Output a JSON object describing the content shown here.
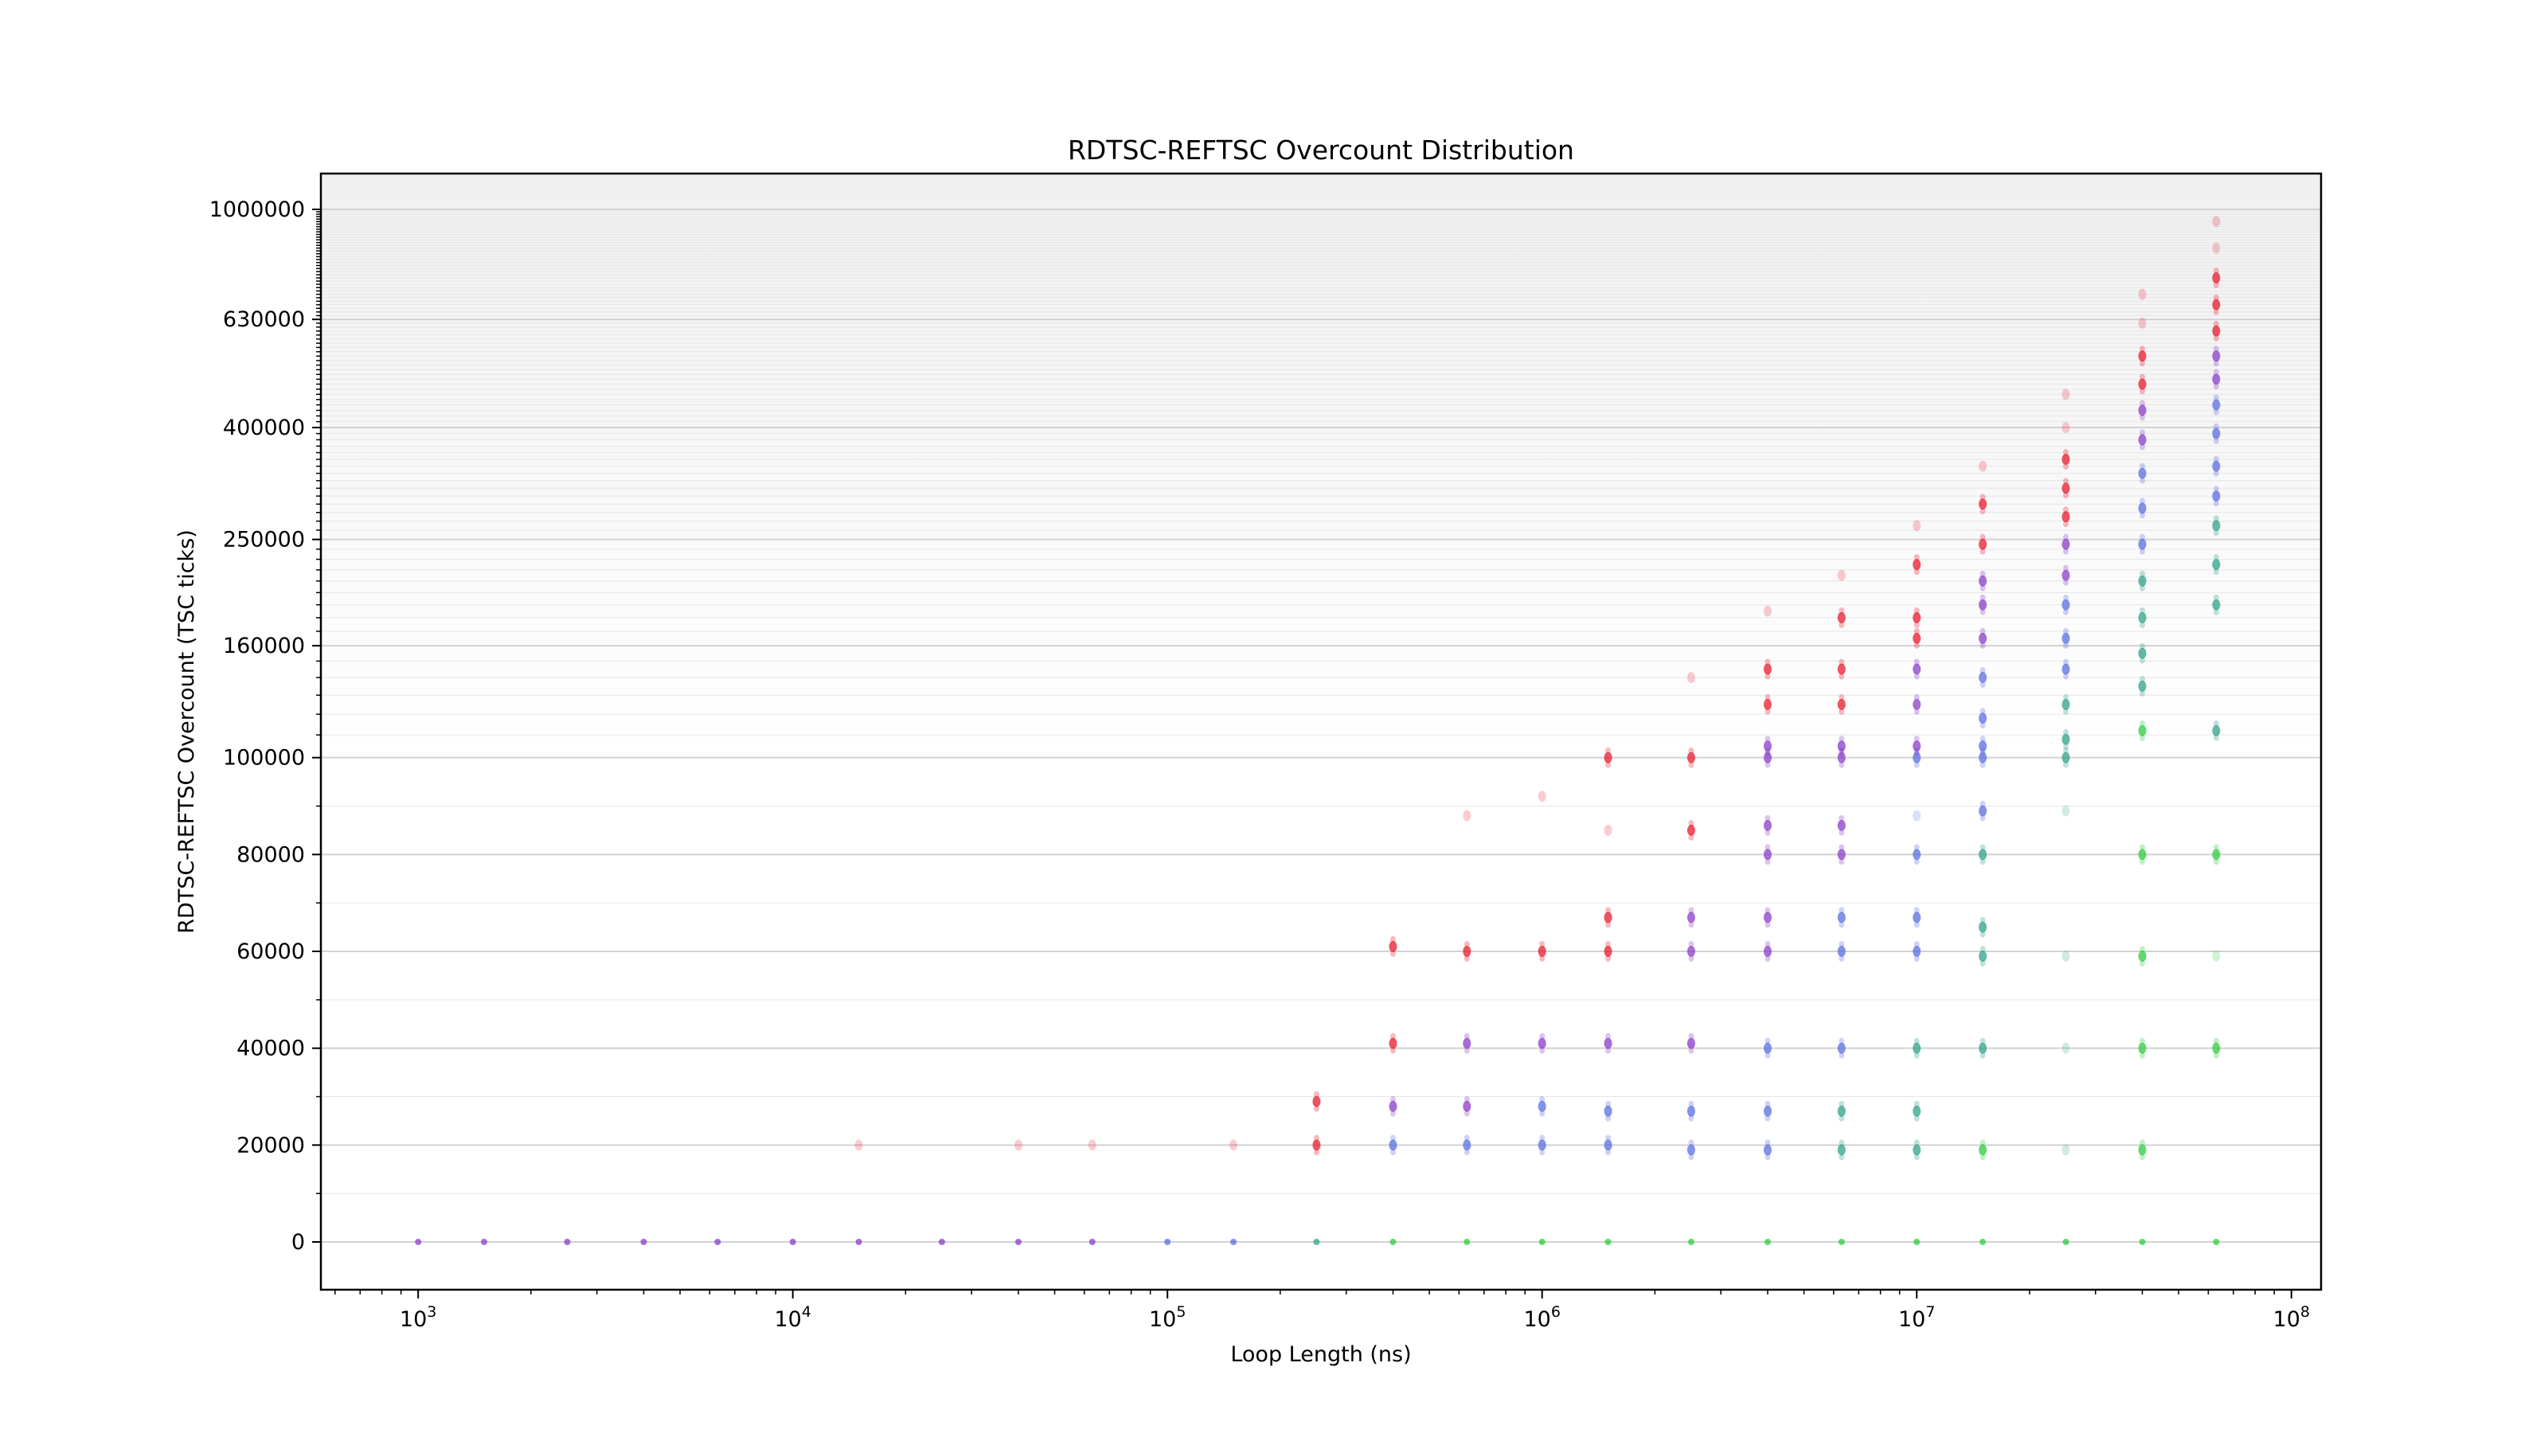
{
  "chart_data": {
    "type": "scatter",
    "title": "RDTSC-REFTSC Overcount Distribution",
    "xlabel": "Loop Length (ns)",
    "ylabel": "RDTSC-REFTSC Overcount (TSC ticks)",
    "x_scale": "log",
    "y_scale": "symlog",
    "xlim": [
      550,
      120000000
    ],
    "ylim": [
      -10000,
      1100000
    ],
    "x_ticks": [
      {
        "value": 1000,
        "base": "10",
        "exp": "3"
      },
      {
        "value": 10000,
        "base": "10",
        "exp": "4"
      },
      {
        "value": 100000,
        "base": "10",
        "exp": "5"
      },
      {
        "value": 1000000,
        "base": "10",
        "exp": "6"
      },
      {
        "value": 10000000,
        "base": "10",
        "exp": "7"
      },
      {
        "value": 100000000,
        "base": "10",
        "exp": "8"
      }
    ],
    "y_ticks": [
      {
        "value": 0,
        "label": "0"
      },
      {
        "value": 20000,
        "label": "20000"
      },
      {
        "value": 40000,
        "label": "40000"
      },
      {
        "value": 60000,
        "label": "60000"
      },
      {
        "value": 80000,
        "label": "80000"
      },
      {
        "value": 100000,
        "label": "100000"
      },
      {
        "value": 160000,
        "label": "160000"
      },
      {
        "value": 250000,
        "label": "250000"
      },
      {
        "value": 400000,
        "label": "400000"
      },
      {
        "value": 630000,
        "label": "630000"
      },
      {
        "value": 1000000,
        "label": "1000000"
      }
    ],
    "grid": true,
    "legend": "none",
    "series_colors": {
      "red": "#e8192c",
      "purple": "#8a3cc8",
      "blue": "#5a6ee0",
      "teal": "#2fa08a",
      "green": "#2ecc40"
    },
    "x_positions": [
      1000,
      1500,
      2500,
      4000,
      6300,
      10000,
      15000,
      25000,
      40000,
      63000,
      100000,
      150000,
      250000,
      400000,
      630000,
      1000000,
      1500000,
      2500000,
      4000000,
      6300000,
      10000000,
      15000000,
      25000000,
      40000000,
      63000000
    ],
    "clusters": [
      {
        "x": 1000,
        "y": 0,
        "color": "purple"
      },
      {
        "x": 1500,
        "y": 0,
        "color": "purple"
      },
      {
        "x": 2500,
        "y": 0,
        "color": "purple"
      },
      {
        "x": 4000,
        "y": 0,
        "color": "purple"
      },
      {
        "x": 6300,
        "y": 0,
        "color": "purple"
      },
      {
        "x": 10000,
        "y": 0,
        "color": "purple"
      },
      {
        "x": 15000,
        "y": 0,
        "color": "purple"
      },
      {
        "x": 25000,
        "y": 0,
        "color": "purple"
      },
      {
        "x": 40000,
        "y": 0,
        "color": "purple"
      },
      {
        "x": 63000,
        "y": 0,
        "color": "purple"
      },
      {
        "x": 100000,
        "y": 0,
        "color": "blue"
      },
      {
        "x": 150000,
        "y": 0,
        "color": "blue"
      },
      {
        "x": 250000,
        "y": 0,
        "color": "teal"
      },
      {
        "x": 400000,
        "y": 0,
        "color": "green"
      },
      {
        "x": 630000,
        "y": 0,
        "color": "green"
      },
      {
        "x": 1000000,
        "y": 0,
        "color": "green"
      },
      {
        "x": 1500000,
        "y": 0,
        "color": "green"
      },
      {
        "x": 2500000,
        "y": 0,
        "color": "green"
      },
      {
        "x": 4000000,
        "y": 0,
        "color": "green"
      },
      {
        "x": 6300000,
        "y": 0,
        "color": "green"
      },
      {
        "x": 10000000,
        "y": 0,
        "color": "green"
      },
      {
        "x": 15000000,
        "y": 0,
        "color": "green"
      },
      {
        "x": 25000000,
        "y": 0,
        "color": "green"
      },
      {
        "x": 40000000,
        "y": 0,
        "color": "green"
      },
      {
        "x": 63000000,
        "y": 0,
        "color": "green"
      },
      {
        "x": 15000,
        "y": 20000,
        "color": "red",
        "faint": true
      },
      {
        "x": 40000,
        "y": 20000,
        "color": "red",
        "faint": true
      },
      {
        "x": 63000,
        "y": 20000,
        "color": "red",
        "faint": true
      },
      {
        "x": 150000,
        "y": 20000,
        "color": "red",
        "faint": true
      },
      {
        "x": 250000,
        "y": 20000,
        "color": "red"
      },
      {
        "x": 250000,
        "y": 29000,
        "color": "red"
      },
      {
        "x": 400000,
        "y": 20000,
        "color": "blue"
      },
      {
        "x": 400000,
        "y": 28000,
        "color": "purple"
      },
      {
        "x": 400000,
        "y": 41000,
        "color": "red"
      },
      {
        "x": 400000,
        "y": 61000,
        "color": "red"
      },
      {
        "x": 630000,
        "y": 20000,
        "color": "blue"
      },
      {
        "x": 630000,
        "y": 28000,
        "color": "purple"
      },
      {
        "x": 630000,
        "y": 41000,
        "color": "purple"
      },
      {
        "x": 630000,
        "y": 60000,
        "color": "red"
      },
      {
        "x": 630000,
        "y": 88000,
        "color": "red",
        "faint": true
      },
      {
        "x": 1000000,
        "y": 20000,
        "color": "blue"
      },
      {
        "x": 1000000,
        "y": 28000,
        "color": "blue"
      },
      {
        "x": 1000000,
        "y": 41000,
        "color": "purple"
      },
      {
        "x": 1000000,
        "y": 60000,
        "color": "red"
      },
      {
        "x": 1000000,
        "y": 92000,
        "color": "red",
        "faint": true
      },
      {
        "x": 1500000,
        "y": 20000,
        "color": "blue"
      },
      {
        "x": 1500000,
        "y": 27000,
        "color": "blue"
      },
      {
        "x": 1500000,
        "y": 41000,
        "color": "purple"
      },
      {
        "x": 1500000,
        "y": 60000,
        "color": "red"
      },
      {
        "x": 1500000,
        "y": 67000,
        "color": "red"
      },
      {
        "x": 1500000,
        "y": 85000,
        "color": "red",
        "faint": true
      },
      {
        "x": 1500000,
        "y": 100000,
        "color": "red"
      },
      {
        "x": 2500000,
        "y": 19000,
        "color": "blue"
      },
      {
        "x": 2500000,
        "y": 27000,
        "color": "blue"
      },
      {
        "x": 2500000,
        "y": 41000,
        "color": "purple"
      },
      {
        "x": 2500000,
        "y": 60000,
        "color": "purple"
      },
      {
        "x": 2500000,
        "y": 67000,
        "color": "purple"
      },
      {
        "x": 2500000,
        "y": 85000,
        "color": "red"
      },
      {
        "x": 2500000,
        "y": 100000,
        "color": "red"
      },
      {
        "x": 2500000,
        "y": 140000,
        "color": "red",
        "faint": true
      },
      {
        "x": 4000000,
        "y": 19000,
        "color": "blue"
      },
      {
        "x": 4000000,
        "y": 27000,
        "color": "blue"
      },
      {
        "x": 4000000,
        "y": 40000,
        "color": "blue"
      },
      {
        "x": 4000000,
        "y": 60000,
        "color": "purple"
      },
      {
        "x": 4000000,
        "y": 67000,
        "color": "purple"
      },
      {
        "x": 4000000,
        "y": 80000,
        "color": "purple"
      },
      {
        "x": 4000000,
        "y": 86000,
        "color": "purple"
      },
      {
        "x": 4000000,
        "y": 100000,
        "color": "purple"
      },
      {
        "x": 4000000,
        "y": 105000,
        "color": "purple"
      },
      {
        "x": 4000000,
        "y": 125000,
        "color": "red"
      },
      {
        "x": 4000000,
        "y": 145000,
        "color": "red"
      },
      {
        "x": 4000000,
        "y": 185000,
        "color": "red",
        "faint": true
      },
      {
        "x": 6300000,
        "y": 19000,
        "color": "teal"
      },
      {
        "x": 6300000,
        "y": 27000,
        "color": "teal"
      },
      {
        "x": 6300000,
        "y": 40000,
        "color": "blue"
      },
      {
        "x": 6300000,
        "y": 60000,
        "color": "blue"
      },
      {
        "x": 6300000,
        "y": 67000,
        "color": "blue"
      },
      {
        "x": 6300000,
        "y": 80000,
        "color": "purple"
      },
      {
        "x": 6300000,
        "y": 86000,
        "color": "purple"
      },
      {
        "x": 6300000,
        "y": 100000,
        "color": "purple"
      },
      {
        "x": 6300000,
        "y": 105000,
        "color": "purple"
      },
      {
        "x": 6300000,
        "y": 125000,
        "color": "red"
      },
      {
        "x": 6300000,
        "y": 145000,
        "color": "red"
      },
      {
        "x": 6300000,
        "y": 180000,
        "color": "red"
      },
      {
        "x": 6300000,
        "y": 215000,
        "color": "red",
        "faint": true
      },
      {
        "x": 10000000,
        "y": 19000,
        "color": "teal"
      },
      {
        "x": 10000000,
        "y": 27000,
        "color": "teal"
      },
      {
        "x": 10000000,
        "y": 40000,
        "color": "teal"
      },
      {
        "x": 10000000,
        "y": 60000,
        "color": "blue"
      },
      {
        "x": 10000000,
        "y": 67000,
        "color": "blue"
      },
      {
        "x": 10000000,
        "y": 80000,
        "color": "blue"
      },
      {
        "x": 10000000,
        "y": 88000,
        "color": "blue",
        "faint": true
      },
      {
        "x": 10000000,
        "y": 100000,
        "color": "blue"
      },
      {
        "x": 10000000,
        "y": 105000,
        "color": "purple"
      },
      {
        "x": 10000000,
        "y": 125000,
        "color": "purple"
      },
      {
        "x": 10000000,
        "y": 145000,
        "color": "purple"
      },
      {
        "x": 10000000,
        "y": 165000,
        "color": "red"
      },
      {
        "x": 10000000,
        "y": 180000,
        "color": "red"
      },
      {
        "x": 10000000,
        "y": 225000,
        "color": "red"
      },
      {
        "x": 10000000,
        "y": 265000,
        "color": "red",
        "faint": true
      },
      {
        "x": 15000000,
        "y": 19000,
        "color": "green"
      },
      {
        "x": 15000000,
        "y": 40000,
        "color": "teal"
      },
      {
        "x": 15000000,
        "y": 59000,
        "color": "teal"
      },
      {
        "x": 15000000,
        "y": 65000,
        "color": "teal"
      },
      {
        "x": 15000000,
        "y": 80000,
        "color": "teal"
      },
      {
        "x": 15000000,
        "y": 89000,
        "color": "blue"
      },
      {
        "x": 15000000,
        "y": 100000,
        "color": "blue"
      },
      {
        "x": 15000000,
        "y": 105000,
        "color": "blue"
      },
      {
        "x": 15000000,
        "y": 118000,
        "color": "blue"
      },
      {
        "x": 15000000,
        "y": 140000,
        "color": "blue"
      },
      {
        "x": 15000000,
        "y": 165000,
        "color": "purple"
      },
      {
        "x": 15000000,
        "y": 190000,
        "color": "purple"
      },
      {
        "x": 15000000,
        "y": 210000,
        "color": "purple"
      },
      {
        "x": 15000000,
        "y": 245000,
        "color": "red"
      },
      {
        "x": 15000000,
        "y": 290000,
        "color": "red"
      },
      {
        "x": 15000000,
        "y": 340000,
        "color": "red",
        "faint": true
      },
      {
        "x": 25000000,
        "y": 19000,
        "color": "teal",
        "faint": true
      },
      {
        "x": 25000000,
        "y": 40000,
        "color": "teal",
        "faint": true
      },
      {
        "x": 25000000,
        "y": 59000,
        "color": "teal",
        "faint": true
      },
      {
        "x": 25000000,
        "y": 89000,
        "color": "teal",
        "faint": true
      },
      {
        "x": 25000000,
        "y": 100000,
        "color": "teal"
      },
      {
        "x": 25000000,
        "y": 108000,
        "color": "teal"
      },
      {
        "x": 25000000,
        "y": 125000,
        "color": "teal"
      },
      {
        "x": 25000000,
        "y": 145000,
        "color": "blue"
      },
      {
        "x": 25000000,
        "y": 165000,
        "color": "blue"
      },
      {
        "x": 25000000,
        "y": 190000,
        "color": "blue"
      },
      {
        "x": 25000000,
        "y": 215000,
        "color": "purple"
      },
      {
        "x": 25000000,
        "y": 245000,
        "color": "purple"
      },
      {
        "x": 25000000,
        "y": 275000,
        "color": "red"
      },
      {
        "x": 25000000,
        "y": 310000,
        "color": "red"
      },
      {
        "x": 25000000,
        "y": 350000,
        "color": "red"
      },
      {
        "x": 25000000,
        "y": 400000,
        "color": "red",
        "faint": true
      },
      {
        "x": 25000000,
        "y": 460000,
        "color": "red",
        "faint": true
      },
      {
        "x": 40000000,
        "y": 19000,
        "color": "green"
      },
      {
        "x": 40000000,
        "y": 40000,
        "color": "green"
      },
      {
        "x": 40000000,
        "y": 59000,
        "color": "green"
      },
      {
        "x": 40000000,
        "y": 80000,
        "color": "green"
      },
      {
        "x": 40000000,
        "y": 112000,
        "color": "green"
      },
      {
        "x": 40000000,
        "y": 135000,
        "color": "teal"
      },
      {
        "x": 40000000,
        "y": 155000,
        "color": "teal"
      },
      {
        "x": 40000000,
        "y": 180000,
        "color": "teal"
      },
      {
        "x": 40000000,
        "y": 210000,
        "color": "teal"
      },
      {
        "x": 40000000,
        "y": 245000,
        "color": "blue"
      },
      {
        "x": 40000000,
        "y": 285000,
        "color": "blue"
      },
      {
        "x": 40000000,
        "y": 330000,
        "color": "blue"
      },
      {
        "x": 40000000,
        "y": 380000,
        "color": "purple"
      },
      {
        "x": 40000000,
        "y": 430000,
        "color": "purple"
      },
      {
        "x": 40000000,
        "y": 480000,
        "color": "red"
      },
      {
        "x": 40000000,
        "y": 540000,
        "color": "red"
      },
      {
        "x": 40000000,
        "y": 620000,
        "color": "red",
        "faint": true
      },
      {
        "x": 40000000,
        "y": 700000,
        "color": "red",
        "faint": true
      },
      {
        "x": 63000000,
        "y": 40000,
        "color": "green"
      },
      {
        "x": 63000000,
        "y": 59000,
        "color": "green",
        "faint": true
      },
      {
        "x": 63000000,
        "y": 80000,
        "color": "green"
      },
      {
        "x": 63000000,
        "y": 112000,
        "color": "teal"
      },
      {
        "x": 63000000,
        "y": 190000,
        "color": "teal"
      },
      {
        "x": 63000000,
        "y": 225000,
        "color": "teal"
      },
      {
        "x": 63000000,
        "y": 265000,
        "color": "teal"
      },
      {
        "x": 63000000,
        "y": 300000,
        "color": "blue"
      },
      {
        "x": 63000000,
        "y": 340000,
        "color": "blue"
      },
      {
        "x": 63000000,
        "y": 390000,
        "color": "blue"
      },
      {
        "x": 63000000,
        "y": 440000,
        "color": "blue"
      },
      {
        "x": 63000000,
        "y": 490000,
        "color": "purple"
      },
      {
        "x": 63000000,
        "y": 540000,
        "color": "purple"
      },
      {
        "x": 63000000,
        "y": 600000,
        "color": "red"
      },
      {
        "x": 63000000,
        "y": 670000,
        "color": "red"
      },
      {
        "x": 63000000,
        "y": 750000,
        "color": "red"
      },
      {
        "x": 63000000,
        "y": 850000,
        "color": "red",
        "faint": true
      },
      {
        "x": 63000000,
        "y": 950000,
        "color": "red",
        "faint": true
      }
    ]
  }
}
